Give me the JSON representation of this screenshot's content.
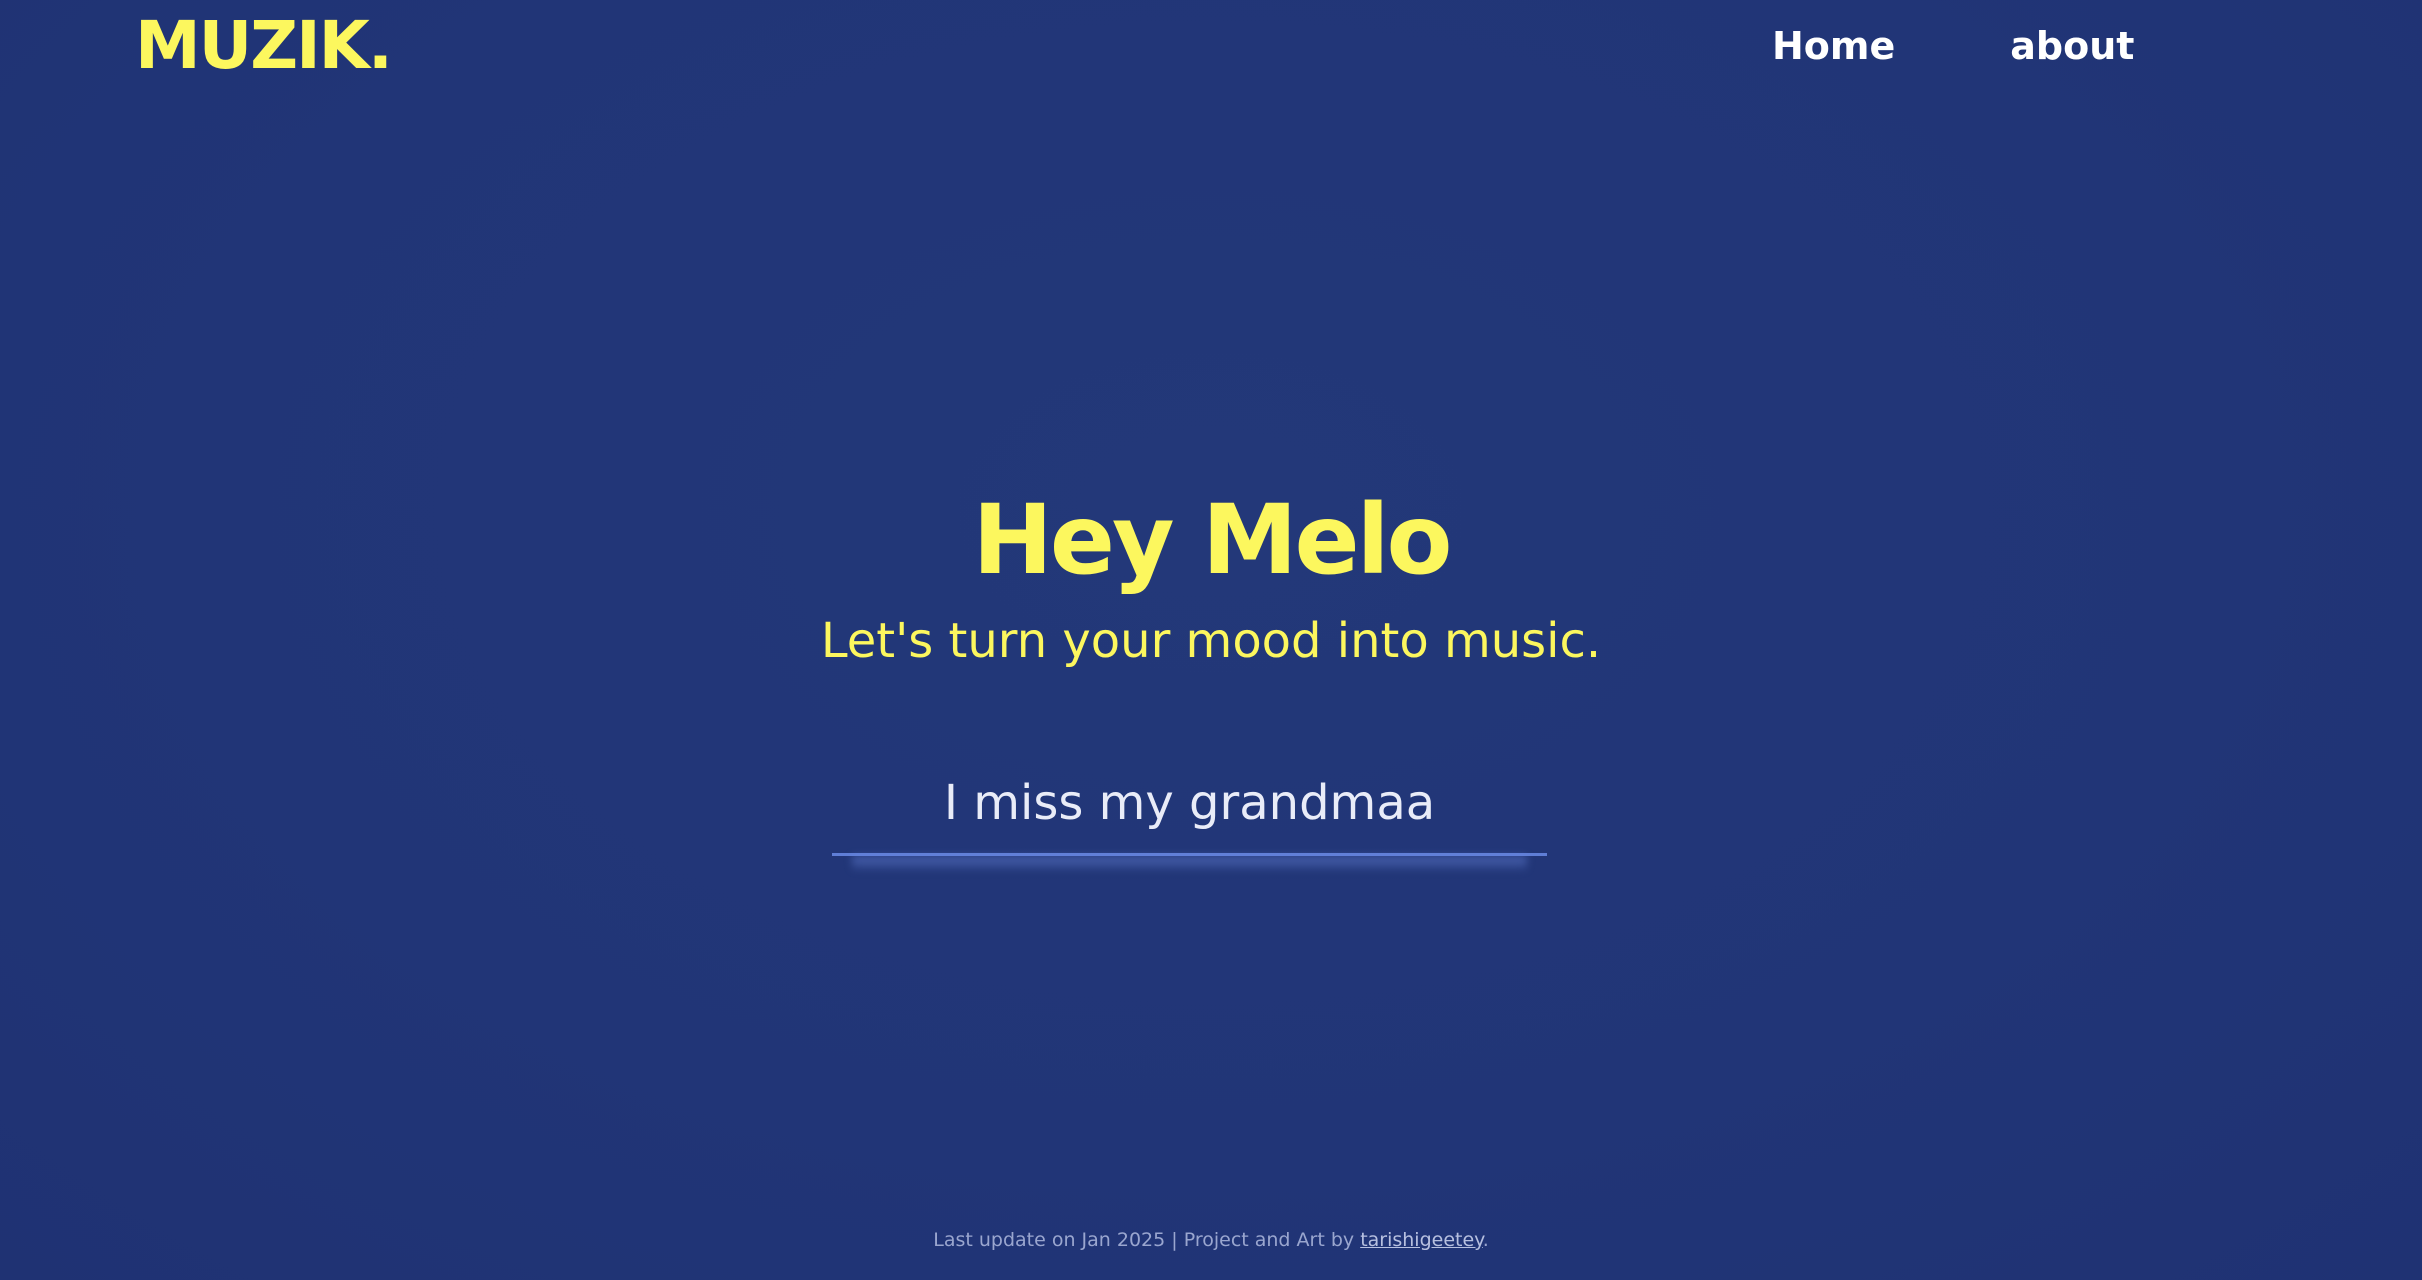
{
  "header": {
    "logo": "MUZIK.",
    "nav": {
      "home": "Home",
      "about": "about"
    }
  },
  "hero": {
    "title": "Hey Melo",
    "subtitle": "Let's turn your mood into music."
  },
  "mood_input": {
    "value": "I miss my grandmaa"
  },
  "footer": {
    "text": "Last update on Jan 2025 | Project and Art by ",
    "author_link": "tarishigeetey",
    "suffix": "."
  },
  "colors": {
    "background": "#213577",
    "accent": "#fcf75e",
    "nav_text": "#ffffff",
    "input_underline": "#5f7ed6"
  }
}
